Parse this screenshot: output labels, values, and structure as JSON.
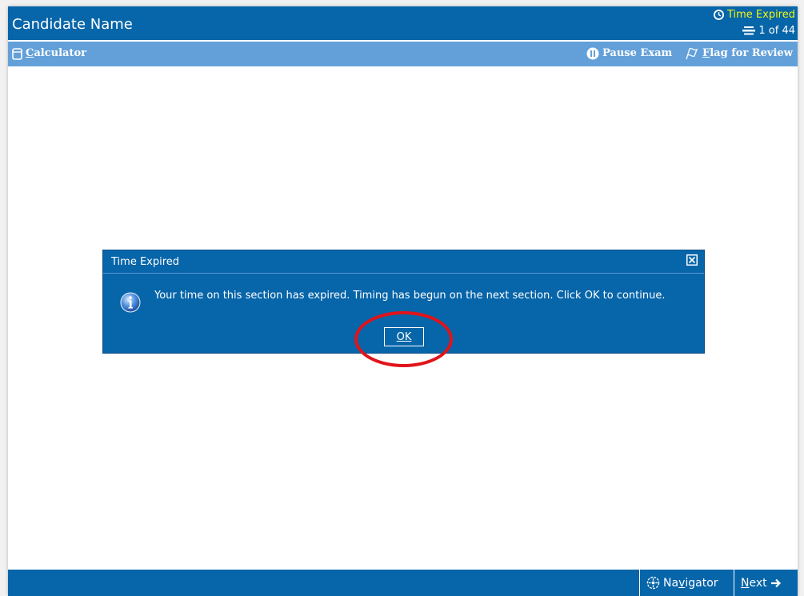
{
  "header": {
    "candidate_name": "Candidate Name",
    "timer_text": "Time Expired",
    "progress_text": "1 of 44"
  },
  "toolbar": {
    "calculator_label_first": "C",
    "calculator_label_rest": "alculator",
    "pause_label": "Pause Exam",
    "flag_label_first": "F",
    "flag_label_rest": "lag for Review"
  },
  "dialog": {
    "title": "Time Expired",
    "message": "Your time on this section has expired. Timing has begun on the next section. Click OK to continue.",
    "ok_label": "OK"
  },
  "footer": {
    "navigator_pre": "Na",
    "navigator_ul": "v",
    "navigator_post": "igator",
    "next_ul": "N",
    "next_post": "ext"
  },
  "colors": {
    "primary": "#0765a9",
    "toolbar": "#63a0d9",
    "timer": "#f3f70a",
    "highlight": "#e0141a"
  },
  "icons": {
    "timer": "clock-icon",
    "progress": "question-list-icon",
    "calculator": "calculator-icon",
    "pause": "pause-icon",
    "flag": "flag-icon",
    "close": "close-box-icon",
    "info": "info-icon",
    "navigator": "navigator-icon",
    "next": "arrow-right-icon"
  }
}
